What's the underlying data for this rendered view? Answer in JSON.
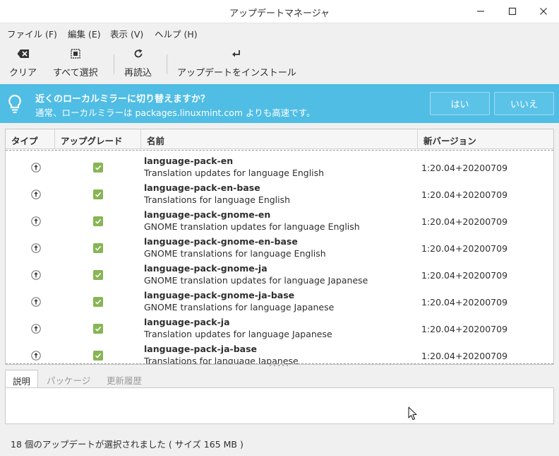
{
  "window": {
    "title": "アップデートマネージャ"
  },
  "menu": [
    "ファイル (F)",
    "編集 (E)",
    "表示 (V)",
    "ヘルプ (H)"
  ],
  "toolbar": {
    "clear": "クリア",
    "select_all": "すべて選択",
    "reload": "再読込",
    "install": "アップデートをインストール"
  },
  "infobar": {
    "title": "近くのローカルミラーに切り替えますか？",
    "message": "通常、ローカルミラーは packages.linuxmint.com よりも高速です。",
    "yes": "はい",
    "no": "いいえ"
  },
  "table": {
    "columns": [
      "タイプ",
      "アップグレード",
      "名前",
      "新バージョン"
    ],
    "rows": [
      {
        "name": "language-pack-en",
        "desc": "Translation updates for language English",
        "version": "1:20.04+20200709",
        "checked": true
      },
      {
        "name": "language-pack-en-base",
        "desc": "Translations for language English",
        "version": "1:20.04+20200709",
        "checked": true
      },
      {
        "name": "language-pack-gnome-en",
        "desc": "GNOME translation updates for language English",
        "version": "1:20.04+20200709",
        "checked": true
      },
      {
        "name": "language-pack-gnome-en-base",
        "desc": "GNOME translations for language English",
        "version": "1:20.04+20200709",
        "checked": true
      },
      {
        "name": "language-pack-gnome-ja",
        "desc": "GNOME translation updates for language Japanese",
        "version": "1:20.04+20200709",
        "checked": true
      },
      {
        "name": "language-pack-gnome-ja-base",
        "desc": "GNOME translations for language Japanese",
        "version": "1:20.04+20200709",
        "checked": true
      },
      {
        "name": "language-pack-ja",
        "desc": "Translation updates for language Japanese",
        "version": "1:20.04+20200709",
        "checked": true
      },
      {
        "name": "language-pack-ja-base",
        "desc": "Translations for language Japanese",
        "version": "1:20.04+20200709",
        "checked": true
      }
    ]
  },
  "tabs": [
    "説明",
    "パッケージ",
    "更新履歴"
  ],
  "status": "18 個のアップデートが選択されました ( サイズ 165 MB )",
  "colors": {
    "infobar": "#50bde4",
    "checkbox": "#87b554"
  }
}
